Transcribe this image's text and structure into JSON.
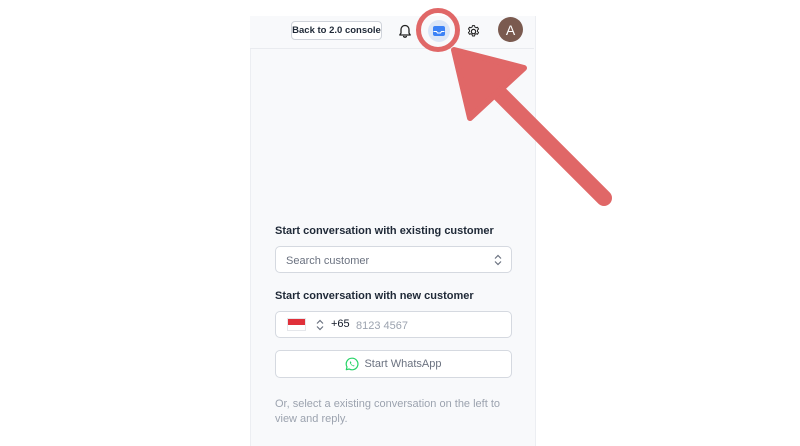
{
  "header": {
    "back_button_label": "Back to 2.0 console",
    "icons": [
      "bell-icon",
      "inbox-icon",
      "gear-icon"
    ],
    "avatar_initial": "A"
  },
  "existing_customer": {
    "title": "Start conversation with existing customer",
    "search_placeholder": "Search customer"
  },
  "new_customer": {
    "title": "Start conversation with new customer",
    "country_code": "+65",
    "phone_placeholder": "8123 4567",
    "whatsapp_button_label": "Start WhatsApp"
  },
  "hint_text": "Or, select a existing conversation on the left to view and reply.",
  "colors": {
    "highlight": "#e06767",
    "whatsapp": "#25d366",
    "inbox_accent": "#3b82f6"
  }
}
